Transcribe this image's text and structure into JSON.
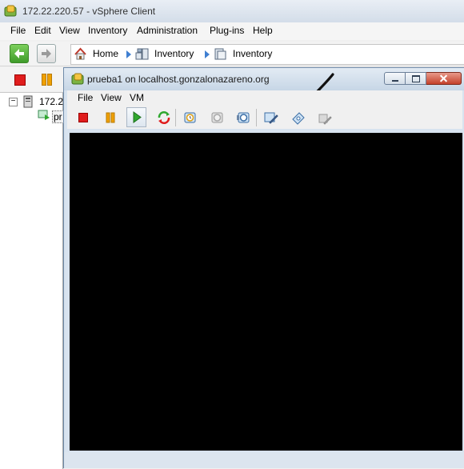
{
  "outer_window": {
    "title": "172.22.220.57 - vSphere Client",
    "menu": [
      "File",
      "Edit",
      "View",
      "Inventory",
      "Administration",
      "Plug-ins",
      "Help"
    ],
    "breadcrumb": [
      "Home",
      "Inventory",
      "Inventory"
    ]
  },
  "inventory_tree": {
    "host_label": "172.2",
    "vm_label": "pr",
    "expander": "−"
  },
  "vm_window": {
    "title": "prueba1 on localhost.gonzalonazareno.org",
    "menu": [
      "File",
      "View",
      "VM"
    ]
  },
  "colors": {
    "stop_red": "#e01d1d",
    "pause_orange": "#f0a000",
    "play_green": "#2fa82f",
    "console_black": "#000000"
  },
  "icons": [
    "back-arrow-icon",
    "forward-arrow-icon",
    "home-icon",
    "inventory-icon",
    "power-off-icon",
    "suspend-icon",
    "power-on-icon",
    "reset-icon",
    "snapshot-icon",
    "revert-icon",
    "manager-icon",
    "edit-settings-icon",
    "cd-dvd-icon",
    "floppy-icon"
  ]
}
